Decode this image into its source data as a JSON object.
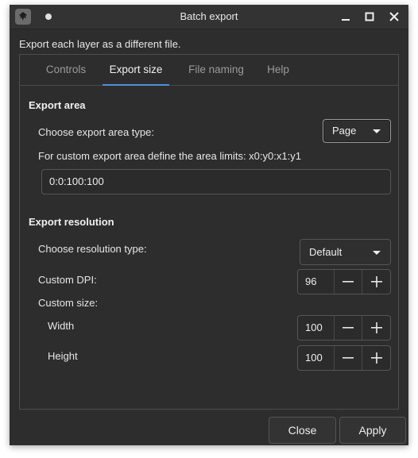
{
  "window": {
    "title": "Batch export",
    "app_icon": "inkscape-icon",
    "controls": [
      "minimize-icon",
      "maximize-icon",
      "close-icon"
    ]
  },
  "subtitle": "Export each layer as a different file.",
  "tabs": [
    {
      "label": "Controls",
      "active": false
    },
    {
      "label": "Export size",
      "active": true
    },
    {
      "label": "File naming",
      "active": false
    },
    {
      "label": "Help",
      "active": false
    }
  ],
  "export_area": {
    "heading": "Export area",
    "type_label": "Choose export area type:",
    "type_value": "Page",
    "custom_label": "For custom export area define the area limits: x0:y0:x1:y1",
    "custom_value": "0:0:100:100"
  },
  "export_resolution": {
    "heading": "Export resolution",
    "type_label": "Choose resolution type:",
    "type_value": "Default",
    "dpi_label": "Custom DPI:",
    "dpi_value": "96",
    "size_label": "Custom size:",
    "width_label": "Width",
    "width_value": "100",
    "height_label": "Height",
    "height_value": "100"
  },
  "buttons": {
    "close": "Close",
    "apply": "Apply"
  },
  "colors": {
    "background": "#2d2d2d",
    "accent": "#4f8fd9",
    "text": "#e8e8e8"
  }
}
